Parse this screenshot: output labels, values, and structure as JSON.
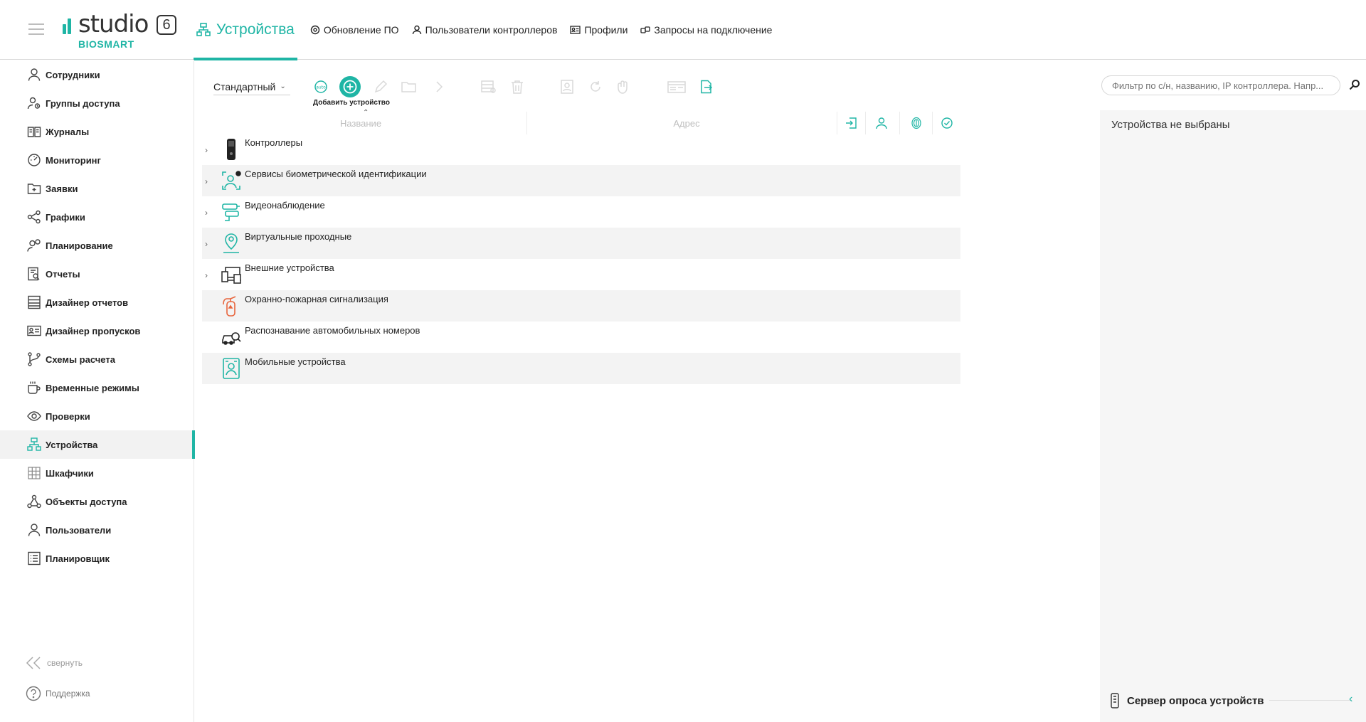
{
  "brand": {
    "word": "studio",
    "version": "6",
    "sub": "BIOSMART",
    "accent": "#1fb5a5"
  },
  "topnav": {
    "active": "Устройства",
    "items": [
      "Обновление ПО",
      "Пользователи контроллеров",
      "Профили",
      "Запросы на подключение"
    ]
  },
  "sidebar": {
    "items": [
      {
        "label": "Сотрудники",
        "icon": "user-icon"
      },
      {
        "label": "Группы доступа",
        "icon": "users-group-icon"
      },
      {
        "label": "Журналы",
        "icon": "book-icon"
      },
      {
        "label": "Мониторинг",
        "icon": "gauge-icon"
      },
      {
        "label": "Заявки",
        "icon": "folder-add-icon"
      },
      {
        "label": "Графики",
        "icon": "share-icon"
      },
      {
        "label": "Планирование",
        "icon": "user-clock-icon"
      },
      {
        "label": "Отчеты",
        "icon": "report-icon"
      },
      {
        "label": "Дизайнер отчетов",
        "icon": "report-designer-icon"
      },
      {
        "label": "Дизайнер пропусков",
        "icon": "id-card-icon"
      },
      {
        "label": "Схемы расчета",
        "icon": "branch-icon"
      },
      {
        "label": "Временные режимы",
        "icon": "cup-icon"
      },
      {
        "label": "Проверки",
        "icon": "eye-icon"
      },
      {
        "label": "Устройства",
        "icon": "devices-icon"
      },
      {
        "label": "Шкафчики",
        "icon": "lockers-icon"
      },
      {
        "label": "Объекты доступа",
        "icon": "objects-icon"
      },
      {
        "label": "Пользователи",
        "icon": "user-icon"
      },
      {
        "label": "Планировщик",
        "icon": "list-icon"
      }
    ],
    "active_index": 13,
    "collapse_label": "свернуть",
    "support_label": "Поддержка"
  },
  "toolbar": {
    "view": "Стандартный",
    "add_label": "Добавить устройство",
    "search_placeholder": "Фильтр по с/н, названию, IP контроллера. Напр..."
  },
  "table": {
    "columns": [
      "Название",
      "Адрес"
    ],
    "rows": [
      {
        "label": "Контроллеры",
        "icon": "controller-icon",
        "expandable": true
      },
      {
        "label": "Сервисы биометрической идентификации",
        "icon": "face-id-icon",
        "expandable": true
      },
      {
        "label": "Видеонаблюдение",
        "icon": "cctv-icon",
        "expandable": true
      },
      {
        "label": "Виртуальные проходные",
        "icon": "virtual-pass-icon",
        "expandable": true
      },
      {
        "label": "Внешние устройства",
        "icon": "external-devices-icon",
        "expandable": true
      },
      {
        "label": "Охранно-пожарная сигнализация",
        "icon": "fire-extinguisher-icon",
        "expandable": false
      },
      {
        "label": "Распознавание автомобильных номеров",
        "icon": "car-search-icon",
        "expandable": false
      },
      {
        "label": "Мобильные устройства",
        "icon": "mobile-id-icon",
        "expandable": false
      }
    ]
  },
  "right_panel": {
    "empty_text": "Устройства не выбраны",
    "server_label": "Сервер опроса устройств"
  }
}
